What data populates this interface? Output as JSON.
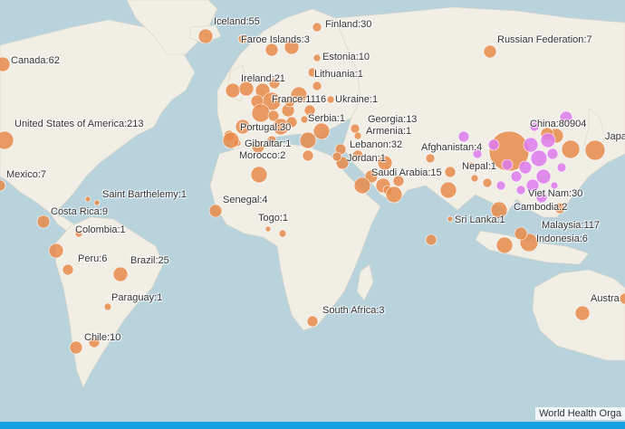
{
  "colors": {
    "ocean": "#b9d3dd",
    "land": "#f1eee6",
    "marker_orange": "#e8894a",
    "marker_purple": "#dd7aed",
    "bottom_bar": "#14a0e0"
  },
  "labels": [
    {
      "name": "iceland",
      "text": "Iceland:55"
    },
    {
      "name": "finland",
      "text": "Finland:30"
    },
    {
      "name": "faroe-islands",
      "text": "Faroe Islands:3"
    },
    {
      "name": "russian-federation",
      "text": "Russian Federation:7"
    },
    {
      "name": "canada",
      "text": "Canada:62"
    },
    {
      "name": "estonia",
      "text": "Estonia:10"
    },
    {
      "name": "lithuania",
      "text": "Lithuania:1"
    },
    {
      "name": "ireland",
      "text": "Ireland:21"
    },
    {
      "name": "france",
      "text": "France:1116"
    },
    {
      "name": "ukraine",
      "text": "Ukraine:1"
    },
    {
      "name": "united-states",
      "text": "United States of America:213"
    },
    {
      "name": "serbia",
      "text": "Serbia:1"
    },
    {
      "name": "georgia",
      "text": "Georgia:13"
    },
    {
      "name": "portugal",
      "text": "Portugal:30"
    },
    {
      "name": "armenia",
      "text": "Armenia:1"
    },
    {
      "name": "china",
      "text": "China:80904"
    },
    {
      "name": "japan",
      "text": "Japa"
    },
    {
      "name": "gibraltar",
      "text": "Gibraltar:1"
    },
    {
      "name": "lebanon",
      "text": "Lebanon:32"
    },
    {
      "name": "afghanistan",
      "text": "Afghanistan:4"
    },
    {
      "name": "mexico",
      "text": "Mexico:7"
    },
    {
      "name": "morocco",
      "text": "Morocco:2"
    },
    {
      "name": "jordan",
      "text": "Jordan:1"
    },
    {
      "name": "nepal",
      "text": "Nepal:1"
    },
    {
      "name": "saudi-arabia",
      "text": "Saudi Arabia:15"
    },
    {
      "name": "saint-barthelemy",
      "text": "Saint Barthelemy:1"
    },
    {
      "name": "viet-nam",
      "text": "Viet Nam:30"
    },
    {
      "name": "senegal",
      "text": "Senegal:4"
    },
    {
      "name": "costa-rica",
      "text": "Costa Rica:9"
    },
    {
      "name": "cambodia",
      "text": "Cambodia:2"
    },
    {
      "name": "togo",
      "text": "Togo:1"
    },
    {
      "name": "sri-lanka",
      "text": "Sri Lanka:1"
    },
    {
      "name": "colombia",
      "text": "Colombia:1"
    },
    {
      "name": "malaysia",
      "text": "Malaysia:117"
    },
    {
      "name": "indonesia",
      "text": "Indonesia:6"
    },
    {
      "name": "peru",
      "text": "Peru:6"
    },
    {
      "name": "brazil",
      "text": "Brazil:25"
    },
    {
      "name": "australia",
      "text": "Austra"
    },
    {
      "name": "paraguay",
      "text": "Paraguay:1"
    },
    {
      "name": "south-africa",
      "text": "South Africa:3"
    },
    {
      "name": "chile",
      "text": "Chile:10"
    }
  ],
  "attribution": "World Health Orga"
}
